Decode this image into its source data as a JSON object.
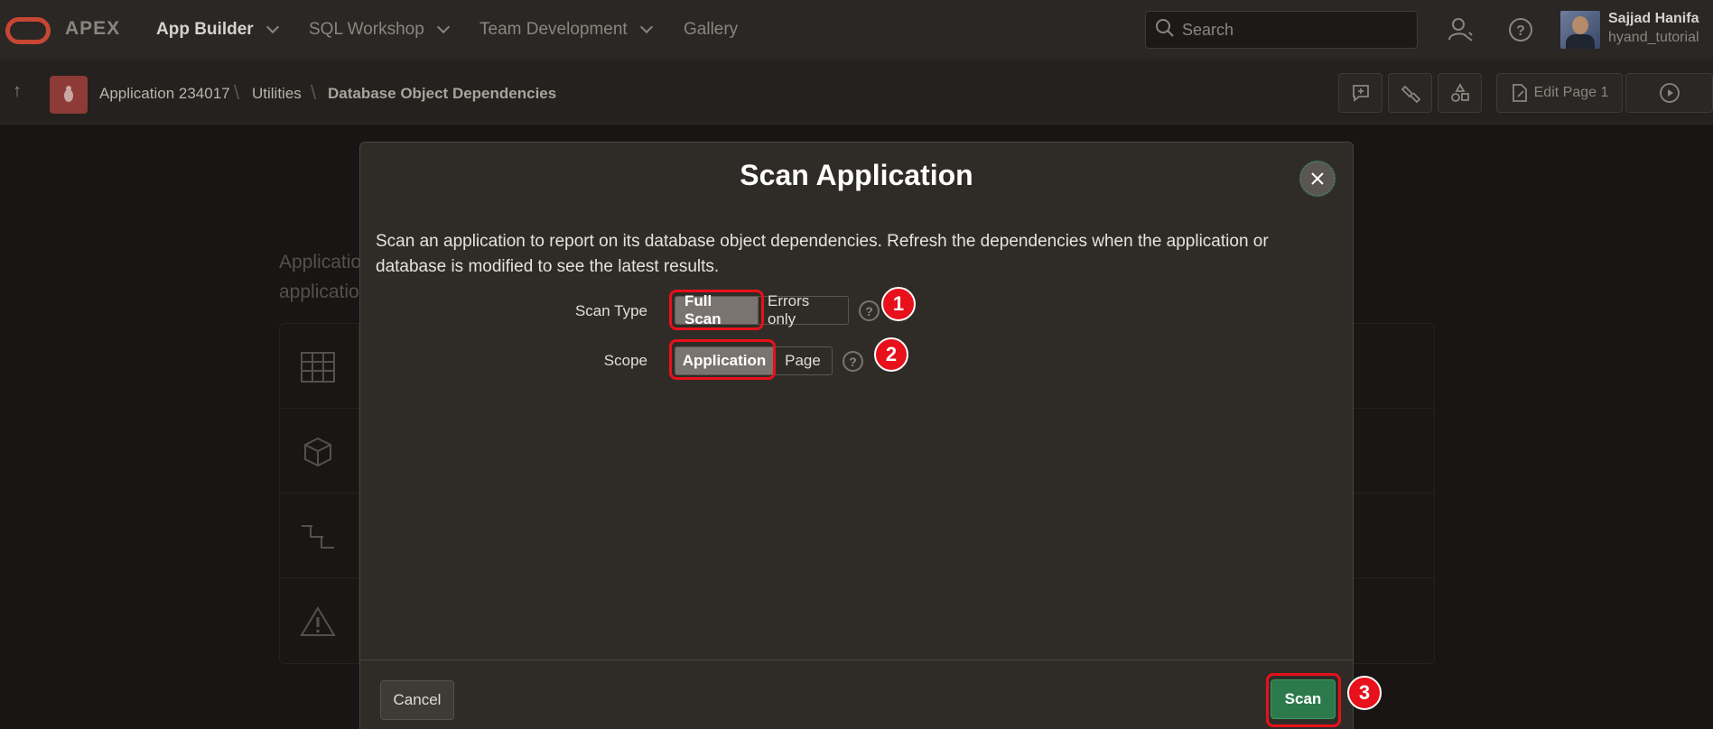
{
  "topnav": {
    "brand": "APEX",
    "items": [
      "App Builder",
      "SQL Workshop",
      "Team Development",
      "Gallery"
    ],
    "search_placeholder": "Search",
    "user_name": "Sajjad Hanifa",
    "user_workspace": "hyand_tutorial"
  },
  "breadcrumb": {
    "items": [
      "Application 234017",
      "Utilities",
      "Database Object Dependencies"
    ]
  },
  "toolbar": {
    "edit_page_label": "Edit Page 1"
  },
  "background": {
    "line1": "Applicatio",
    "line2": "applicatio"
  },
  "dialog": {
    "title": "Scan Application",
    "description": "Scan an application to report on its database object dependencies. Refresh the dependencies when the application or database is modified to see the latest results.",
    "scan_type": {
      "label": "Scan Type",
      "options": [
        "Full Scan",
        "Errors only"
      ],
      "selected": "Full Scan"
    },
    "scope": {
      "label": "Scope",
      "options": [
        "Application",
        "Page"
      ],
      "selected": "Application"
    },
    "cancel_label": "Cancel",
    "scan_label": "Scan"
  },
  "annotations": {
    "markers": [
      "1",
      "2",
      "3"
    ],
    "highlight_color": "#e8101a"
  },
  "colors": {
    "accent_green": "#2c7a4c",
    "brand_red": "#c74634"
  }
}
